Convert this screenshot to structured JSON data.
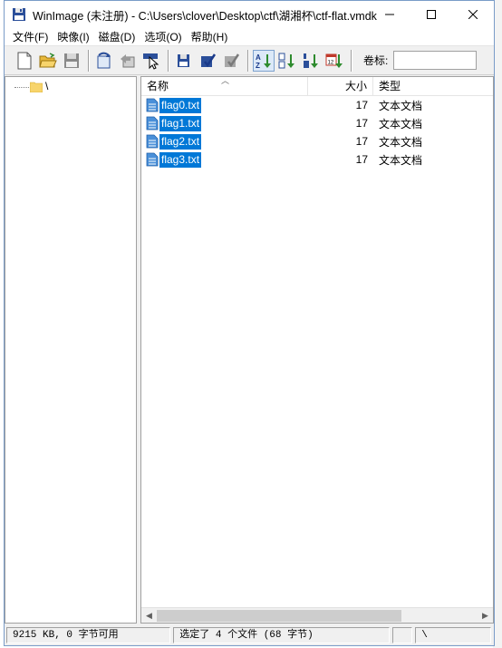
{
  "window": {
    "title": "WinImage (未注册) - C:\\Users\\clover\\Desktop\\ctf\\湖湘杯\\ctf-flat.vmdk"
  },
  "menu": [
    "文件(F)",
    "映像(I)",
    "磁盘(D)",
    "选项(O)",
    "帮助(H)"
  ],
  "toolbar": {
    "volume_label": "卷标:",
    "volume_value": ""
  },
  "tree": {
    "root_label": "\\"
  },
  "list": {
    "columns": {
      "name": "名称",
      "size": "大小",
      "type": "类型"
    },
    "rows": [
      {
        "name": "flag0.txt",
        "size": "17",
        "type": "文本文档"
      },
      {
        "name": "flag1.txt",
        "size": "17",
        "type": "文本文档"
      },
      {
        "name": "flag2.txt",
        "size": "17",
        "type": "文本文档"
      },
      {
        "name": "flag3.txt",
        "size": "17",
        "type": "文本文档"
      }
    ]
  },
  "status": {
    "free": "9215 KB, 0 字节可用",
    "selection": "选定了 4 个文件 (68 字节)",
    "empty": "",
    "path": "\\"
  },
  "colors": {
    "selection": "#0078d7",
    "folder": "#f7d46b",
    "file_icon": "#4a90d9"
  }
}
